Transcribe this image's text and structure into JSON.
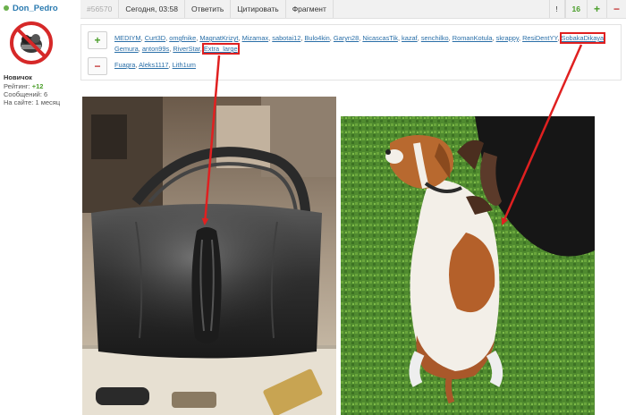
{
  "user": {
    "name": "Don_Pedro",
    "rank": "Новичок",
    "rating_label": "Рейтинг:",
    "rating_value": "+12",
    "messages": "Сообщений: 6",
    "on_site": "На сайте: 1 месяц"
  },
  "toolbar": {
    "post_number": "#56570",
    "date": "Сегодня, 03:58",
    "reply_label": "Ответить",
    "quote_label": "Цитировать",
    "fragment_label": "Фрагмент",
    "report_label": "!",
    "score": "16",
    "plus_label": "+",
    "minus_label": "−"
  },
  "votes": {
    "plus_label": "+",
    "minus_label": "−",
    "positive": [
      "MEDIYM",
      "Curt3D",
      "omgfnike",
      "MagnatKrizyt",
      "Mizamax",
      "sabotai12",
      "Bulo4kin",
      "Garyn28",
      "NicascasTik",
      "kazaf",
      "senchilko",
      "RomanKotula",
      "skrappy",
      "ResiDentYY",
      "SobakaDikaya",
      "Gemura",
      "anton99s",
      "RiverStar",
      "Extra_large"
    ],
    "negative": [
      "Fuagra",
      "Aleks1117",
      "Lith1um"
    ],
    "highlighted": [
      "SobakaDikaya",
      "Extra_large"
    ]
  },
  "colors": {
    "accent_green": "#4a9e2a",
    "accent_red": "#c43a3a",
    "link_blue": "#2a6fa8",
    "arrow_red": "#e02020"
  }
}
